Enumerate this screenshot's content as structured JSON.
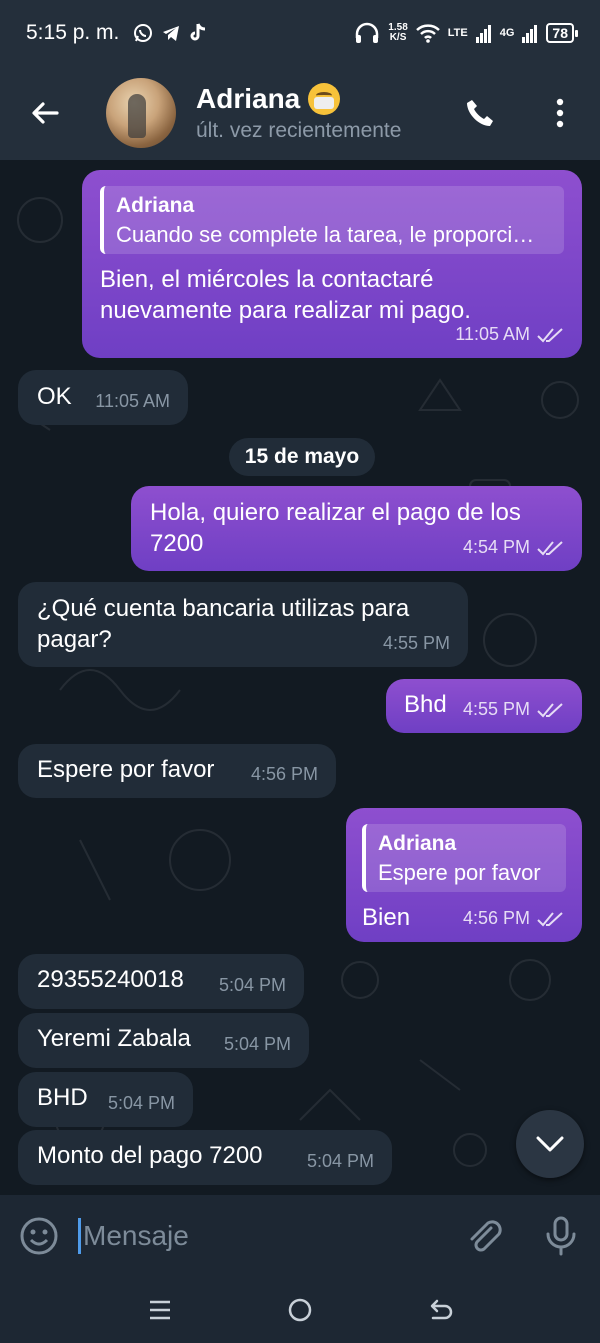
{
  "status_bar": {
    "time": "5:15 p. m.",
    "speed_value": "1.58",
    "speed_unit": "K/S",
    "network_lte": "LTE",
    "network_4g": "4G",
    "battery": "78"
  },
  "header": {
    "contact_name": "Adriana",
    "last_seen": "últ. vez recientemente",
    "icons": [
      "back-arrow-icon",
      "avatar",
      "mask-face-emoji",
      "phone-icon",
      "more-vertical-icon"
    ]
  },
  "messages": [
    {
      "direction": "out",
      "reply_name": "Adriana",
      "reply_text": "Cuando se complete la tarea, le proporci…",
      "text_line1": "Bien, el miércoles la contactaré",
      "text_line2": "nuevamente para realizar mi pago.",
      "time": "11:05 AM",
      "read": true
    },
    {
      "direction": "in",
      "text": "OK",
      "time": "11:05 AM"
    },
    {
      "direction": "out",
      "text_line1": "Hola, quiero realizar el pago de los",
      "text_line2": "7200",
      "time": "4:54 PM",
      "read": true
    },
    {
      "direction": "in",
      "text_line1": "¿Qué cuenta bancaria utilizas para",
      "text_line2": "pagar?",
      "time": "4:55 PM"
    },
    {
      "direction": "out",
      "text": "Bhd",
      "time": "4:55 PM",
      "read": true
    },
    {
      "direction": "in",
      "text": "Espere por favor",
      "time": "4:56 PM"
    },
    {
      "direction": "out",
      "reply_name": "Adriana",
      "reply_text": "Espere por favor",
      "text": "Bien",
      "time": "4:56 PM",
      "read": true
    },
    {
      "direction": "in",
      "text": "29355240018",
      "time": "5:04 PM"
    },
    {
      "direction": "in",
      "text": "Yeremi Zabala",
      "time": "5:04 PM"
    },
    {
      "direction": "in",
      "text": "BHD",
      "time": "5:04 PM"
    },
    {
      "direction": "in",
      "text": "Monto del pago 7200",
      "time": "5:04 PM"
    }
  ],
  "date_separator": "15 de mayo",
  "composer": {
    "placeholder": "Mensaje",
    "icons": [
      "emoji-icon",
      "attach-icon",
      "mic-icon"
    ]
  },
  "colors": {
    "accent_outgoing": "#7c44c2",
    "incoming_bubble": "#212c38",
    "header_bg": "#242f3b",
    "chat_bg": "#121a22"
  }
}
